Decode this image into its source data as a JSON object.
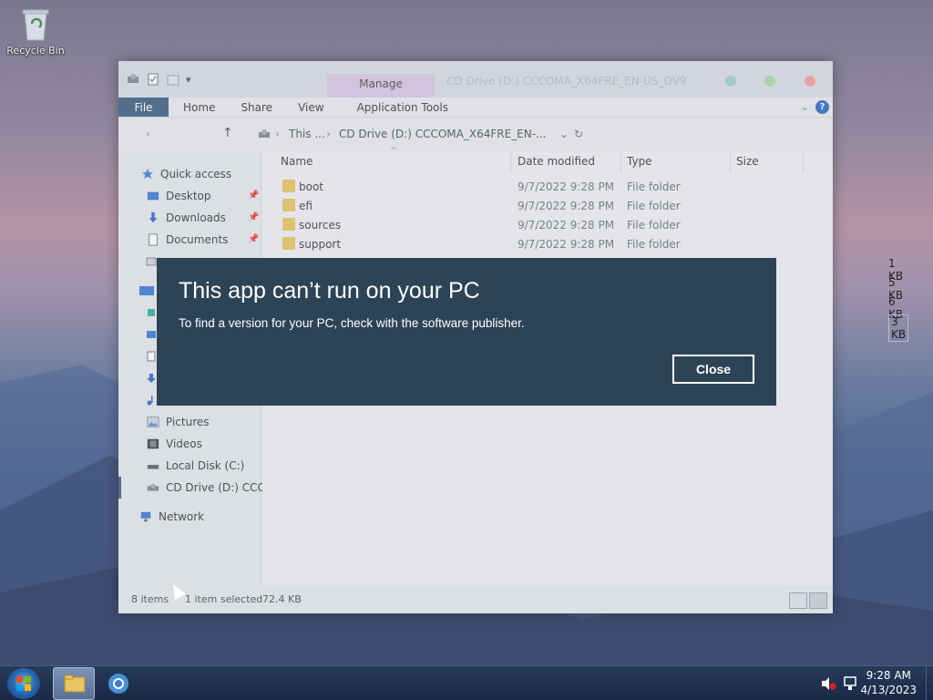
{
  "desktop": {
    "recycle_bin_label": "Recycle Bin"
  },
  "explorer": {
    "qat_dropdown": "▾",
    "manage_tab": "Manage",
    "title": "CD Drive (D:) CCCOMA_X64FRE_EN-US_DV9",
    "ribbon": {
      "file": "File",
      "home": "Home",
      "share": "Share",
      "view": "View",
      "application_tools": "Application Tools"
    },
    "address": {
      "crumb_this_pc": "This ...",
      "crumb_sep": "›",
      "crumb_cd": "CD Drive (D:) CCCOMA_X64FRE_EN-...",
      "refresh": "↻",
      "dropdown": "⌄"
    },
    "nav": {
      "quick_access": "Quick access",
      "desktop": "Desktop",
      "downloads": "Downloads",
      "documents": "Documents",
      "pictures": "Pictures",
      "videos": "Videos",
      "local_disk": "Local Disk (C:)",
      "cd_drive": "CD Drive (D:) CCCO",
      "network": "Network"
    },
    "columns": {
      "name": "Name",
      "date_modified": "Date modified",
      "type": "Type",
      "size": "Size"
    },
    "files": [
      {
        "name": "boot",
        "date": "9/7/2022 9:28 PM",
        "type": "File folder"
      },
      {
        "name": "efi",
        "date": "9/7/2022 9:28 PM",
        "type": "File folder"
      },
      {
        "name": "sources",
        "date": "9/7/2022 9:28 PM",
        "type": "File folder"
      },
      {
        "name": "support",
        "date": "9/7/2022 9:28 PM",
        "type": "File folder"
      }
    ],
    "partial_sizes": [
      "1 KB",
      "5 KB",
      "6 KB",
      "3 KB"
    ],
    "status": {
      "items": "8 items",
      "selected": "1 item selected",
      "size": "72.4 KB"
    }
  },
  "dialog": {
    "title": "This app can’t run on your PC",
    "message": "To find a version for your PC, check with the software publisher.",
    "close_label": "Close"
  },
  "taskbar": {
    "time": "9:28 AM",
    "date": "4/13/2023"
  }
}
